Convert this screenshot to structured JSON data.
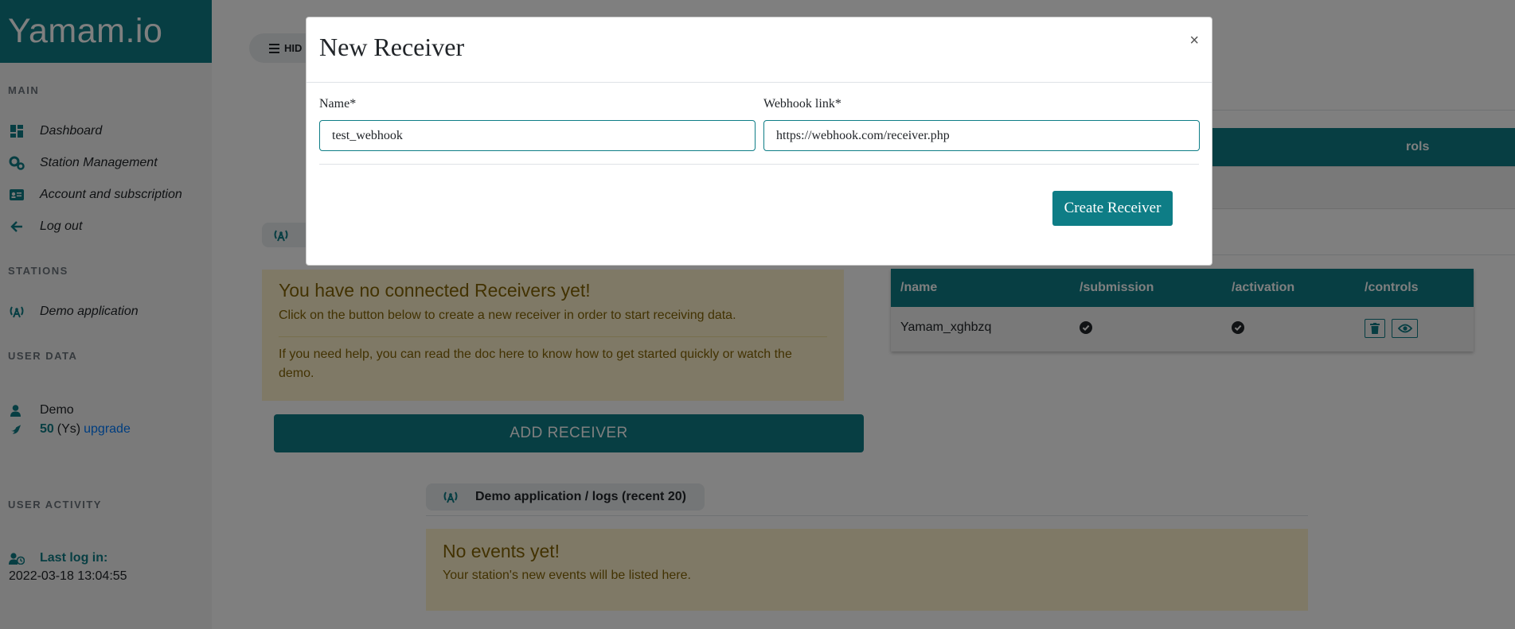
{
  "brand": {
    "name": "Yamam.io"
  },
  "sidebar": {
    "main_title": "MAIN",
    "items": [
      {
        "label": "Dashboard",
        "icon": "dashboard-icon"
      },
      {
        "label": "Station Management",
        "icon": "gears-icon"
      },
      {
        "label": "Account and subscription",
        "icon": "id-card-icon"
      },
      {
        "label": "Log out",
        "icon": "arrow-left-icon"
      }
    ],
    "stations_title": "STATIONS",
    "stations": [
      {
        "label": "Demo application",
        "icon": "broadcast-tower-icon"
      }
    ],
    "user_data_title": "USER DATA",
    "user": {
      "name": "Demo",
      "credits": "50",
      "credits_unit": "(Ys)",
      "upgrade_label": "upgrade"
    },
    "user_activity_title": "USER ACTIVITY",
    "last_login_label": "Last log in:",
    "last_login_value": "2022-03-18 13:04:55"
  },
  "main": {
    "hide_label": "HID",
    "top_table_header_fragment": "rols",
    "receivers_alert": {
      "title": "You have no connected Receivers yet!",
      "text": "Click on the button below to create a new receiver in order to start receiving data.",
      "help": "If you need help, you can read the doc here to know how to get started quickly or watch the demo."
    },
    "add_receiver_label": "ADD RECEIVER",
    "table": {
      "headers": [
        "/name",
        "/submission",
        "/activation",
        "/controls"
      ],
      "rows": [
        {
          "name": "Yamam_xghbzq",
          "submission": true,
          "activation": true
        }
      ]
    },
    "logs_tab_label": "Demo application / logs (recent 20)",
    "events_alert": {
      "title": "No events yet!",
      "text": "Your station's new events will be listed here."
    }
  },
  "modal": {
    "title": "New Receiver",
    "close": "×",
    "name_label": "Name*",
    "name_value": "test_webhook",
    "webhook_label": "Webhook link*",
    "webhook_value": "https://webhook.com/receiver.php",
    "create_label": "Create Receiver"
  },
  "colors": {
    "accent": "#0e7d86",
    "alert_bg": "#fff3cd",
    "alert_text": "#856404",
    "link": "#007bff"
  }
}
